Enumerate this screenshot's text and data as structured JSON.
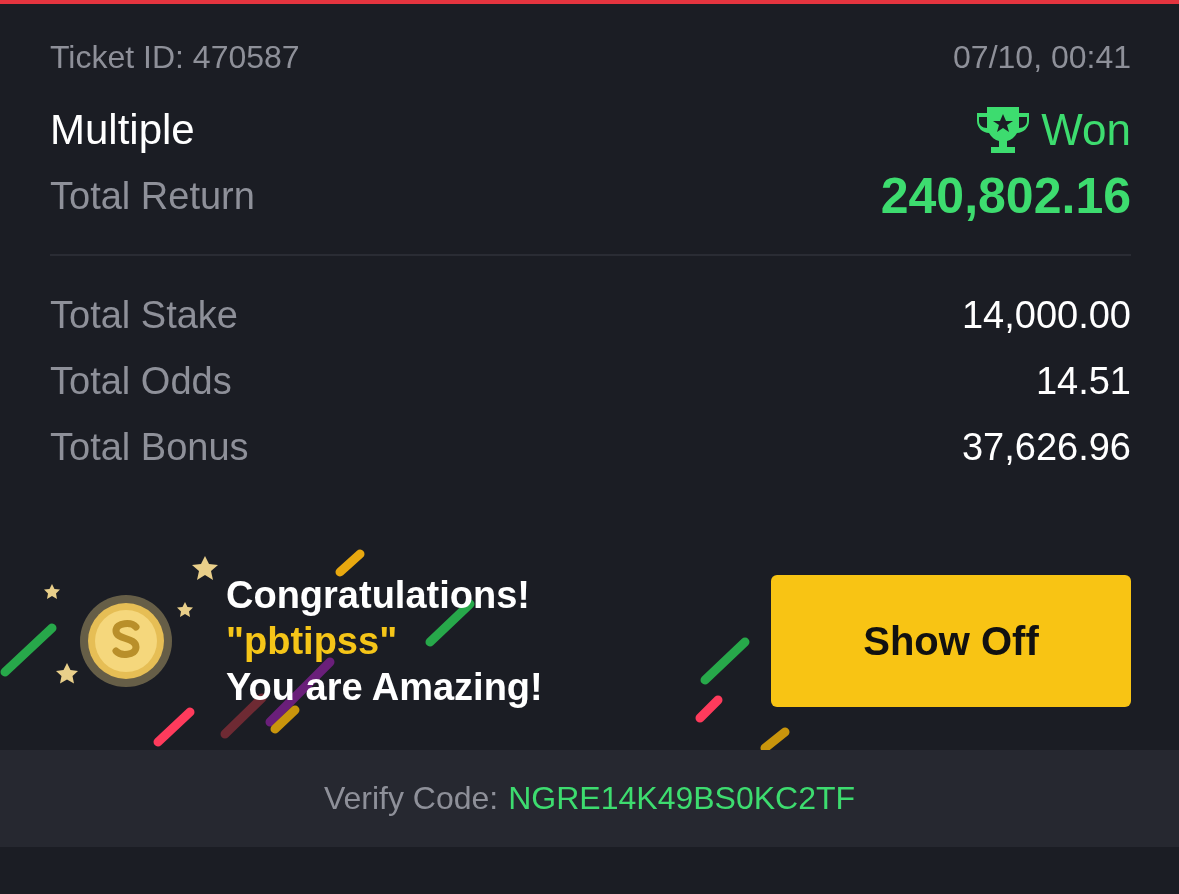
{
  "ticket": {
    "id_label": "Ticket ID: 470587",
    "time": "07/10, 00:41"
  },
  "bet": {
    "type": "Multiple",
    "status": {
      "kind": "won",
      "label": "Won"
    }
  },
  "total_return": {
    "label": "Total Return",
    "value": "240,802.16"
  },
  "details": [
    {
      "label": "Total Stake",
      "value": "14,000.00"
    },
    {
      "label": "Total Odds",
      "value": "14.51"
    },
    {
      "label": "Total Bonus",
      "value": "37,626.96"
    }
  ],
  "banner": {
    "title": "Congratulations!",
    "username": "\"pbtipss\"",
    "message": "You are Amazing!",
    "button": "Show Off"
  },
  "verify": {
    "label": "Verify Code:",
    "code": "NGRE14K49BS0KC2TF"
  }
}
